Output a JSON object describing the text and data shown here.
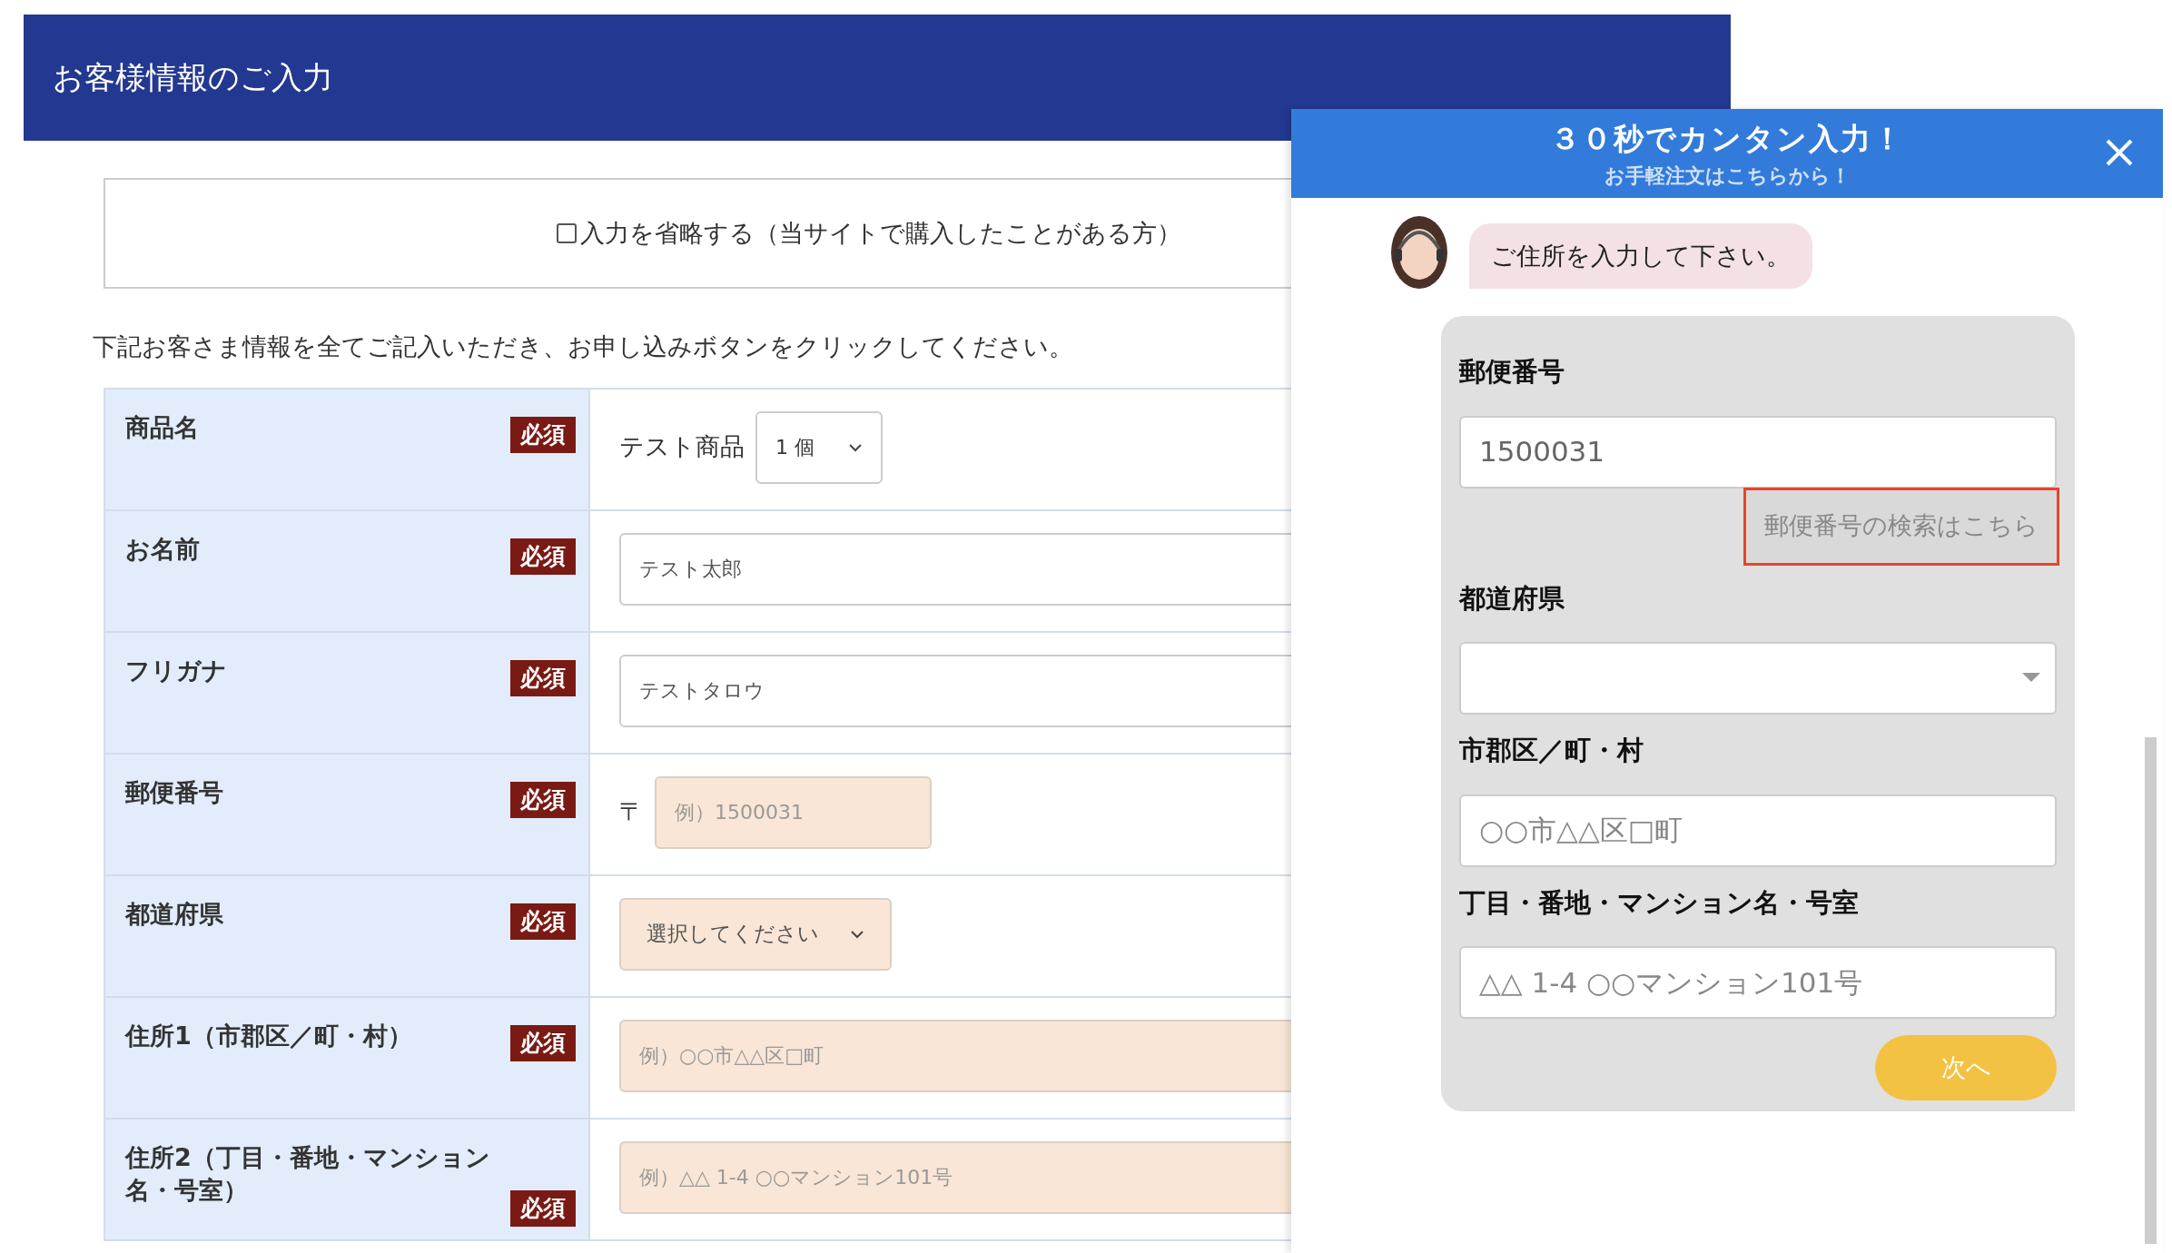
{
  "header": {
    "title": "お客様情報のご入力"
  },
  "skip_option": {
    "label": "入力を省略する（当サイトで購入したことがある方）",
    "checked": false
  },
  "instruction": "下記お客さま情報を全てご記入いただき、お申し込みボタンをクリックしてください。",
  "form_rows": [
    {
      "label": "商品名",
      "badge": "必須",
      "kind": "product",
      "product": "テスト商品",
      "select_value": "1 個"
    },
    {
      "label": "お名前",
      "badge": "必須",
      "kind": "text",
      "value": "テスト太郎",
      "filled": true
    },
    {
      "label": "フリガナ",
      "badge": "必須",
      "kind": "text",
      "value": "テストタロウ",
      "filled": true
    },
    {
      "label": "郵便番号",
      "badge": "必須",
      "kind": "postal",
      "prefix": "〒",
      "placeholder": "例）1500031"
    },
    {
      "label": "都道府県",
      "badge": "必須",
      "kind": "select",
      "placeholder": "選択してください"
    },
    {
      "label": "住所1（市郡区／町・村）",
      "badge": "必須",
      "kind": "text",
      "placeholder": "例）○○市△△区□町",
      "filled": false
    },
    {
      "label": "住所2（丁目・番地・マンション名・号室）",
      "badge": "必須",
      "kind": "text",
      "placeholder": "例）△△ 1-4 ○○マンション101号",
      "filled": false
    }
  ],
  "popup": {
    "title": "３０秒でカンタン入力！",
    "subtitle": "お手軽注文はこちらから！",
    "message": "ご住所を入力して下さい。",
    "fields": [
      {
        "label": "郵便番号",
        "kind": "text",
        "value": "1500031",
        "button": "郵便番号の検索はこちら",
        "highlighted": true
      },
      {
        "label": "都道府県",
        "kind": "select"
      },
      {
        "label": "市郡区／町・村",
        "kind": "text",
        "placeholder": "○○市△△区□町"
      },
      {
        "label": "丁目・番地・マンション名・号室",
        "kind": "text",
        "placeholder": "△△ 1-4 ○○マンション101号"
      }
    ],
    "next_button": "次へ"
  }
}
